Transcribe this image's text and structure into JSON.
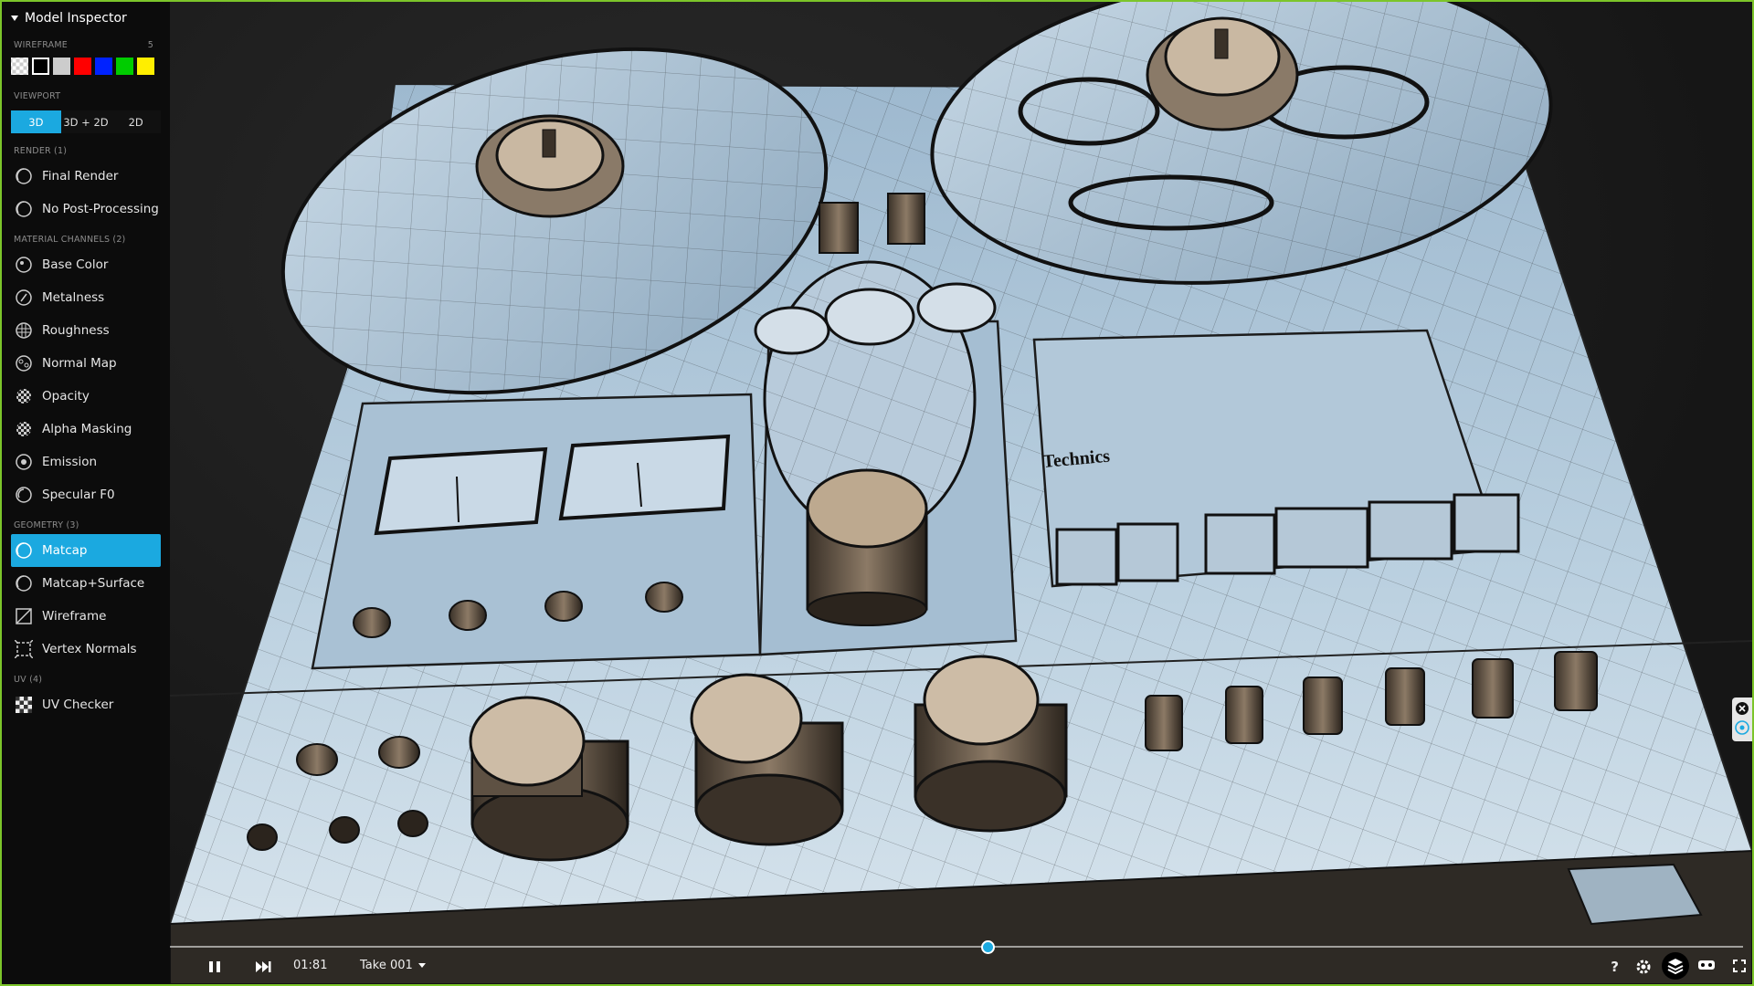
{
  "panel": {
    "title": "Model Inspector"
  },
  "wireframe": {
    "label": "WIREFRAME",
    "opacity_value": "5",
    "swatches": [
      "checker",
      "#000000",
      "#cccccc",
      "#ff0000",
      "#0022ff",
      "#00cc00",
      "#ffee00"
    ]
  },
  "viewport_mode": {
    "label": "VIEWPORT",
    "options": [
      "3D",
      "3D + 2D",
      "2D"
    ],
    "selected": "3D"
  },
  "render": {
    "label": "RENDER (1)",
    "items": [
      "Final Render",
      "No Post-Processing"
    ]
  },
  "material": {
    "label": "MATERIAL CHANNELS (2)",
    "items": [
      "Base Color",
      "Metalness",
      "Roughness",
      "Normal Map",
      "Opacity",
      "Alpha Masking",
      "Emission",
      "Specular F0"
    ]
  },
  "geometry": {
    "label": "GEOMETRY (3)",
    "items": [
      "Matcap",
      "Matcap+Surface",
      "Wireframe",
      "Vertex Normals"
    ],
    "selected": "Matcap"
  },
  "uv": {
    "label": "UV (4)",
    "items": [
      "UV Checker"
    ]
  },
  "playback": {
    "time": "01:81",
    "take": "Take 001",
    "progress": 0.52
  },
  "scene": {
    "brand_text": "Technics"
  },
  "icons": {
    "pause": "pause-icon",
    "next": "skip-forward-icon",
    "help": "help-icon",
    "settings": "gear-icon",
    "layers": "layers-icon",
    "vr": "vr-headset-icon",
    "fullscreen": "fullscreen-icon"
  },
  "colors": {
    "accent": "#1ba9e0",
    "frame_border": "#7cc52a",
    "sidebar_bg": "#0c0c0c"
  }
}
